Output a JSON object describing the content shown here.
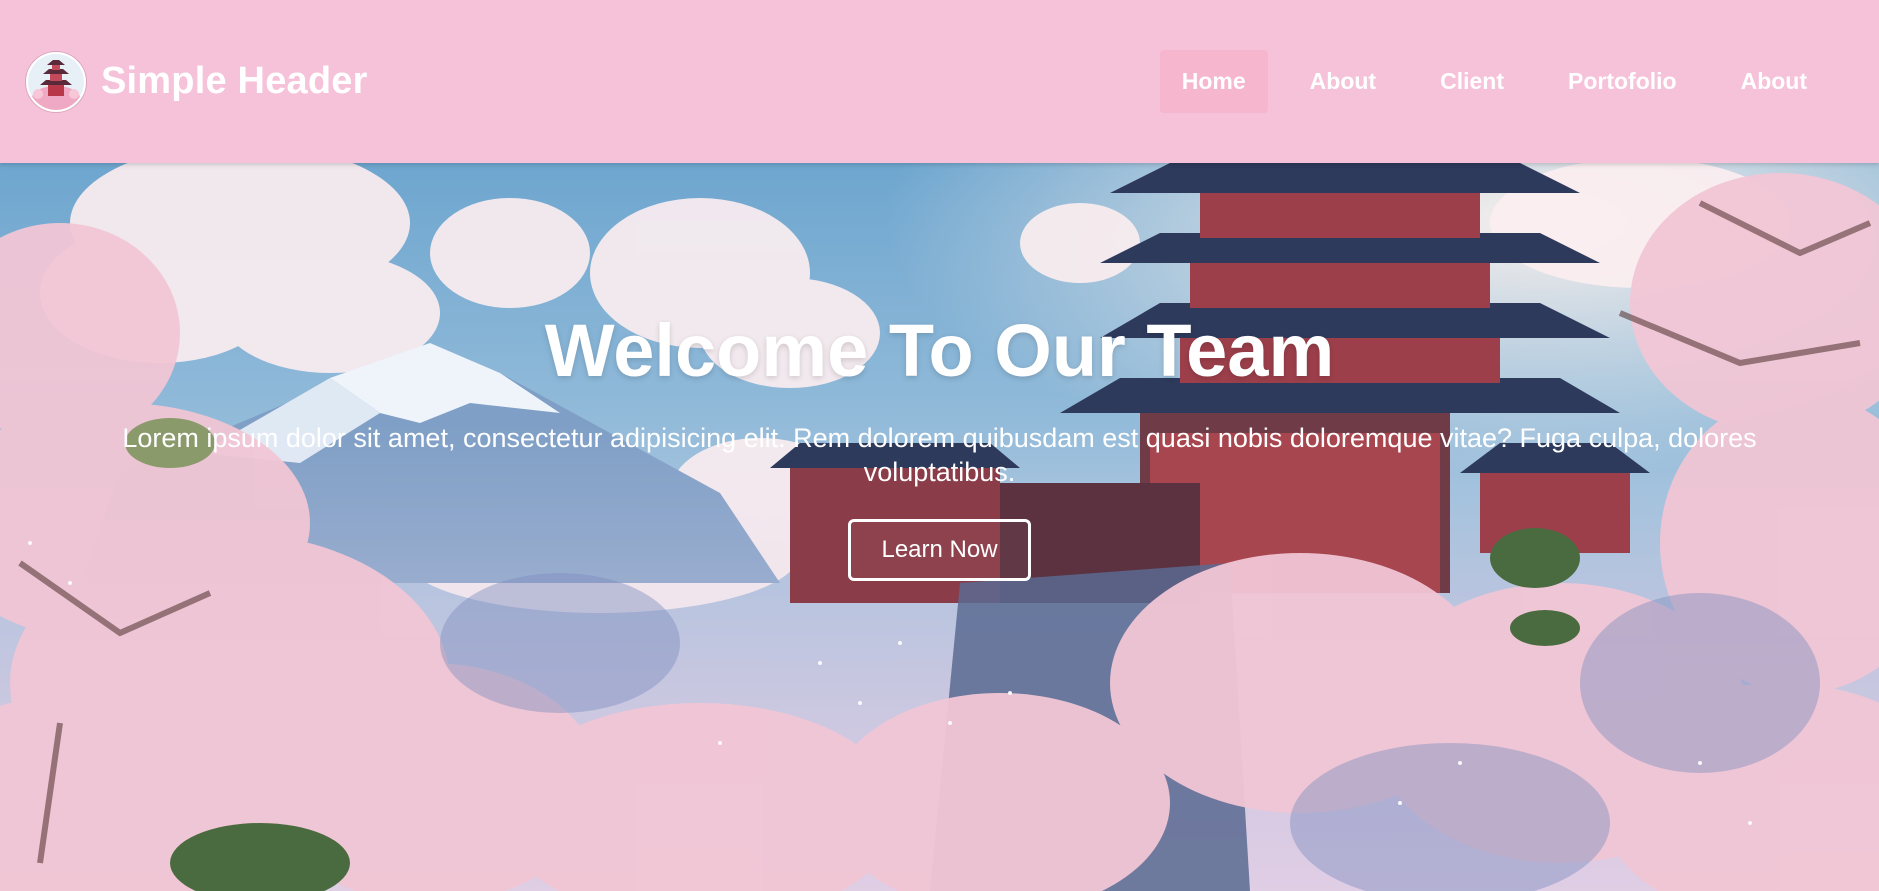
{
  "header": {
    "brand_title": "Simple Header",
    "logo_icon": "pagoda-logo-icon"
  },
  "nav": {
    "items": [
      {
        "label": "Home",
        "active": true
      },
      {
        "label": "About",
        "active": false
      },
      {
        "label": "Client",
        "active": false
      },
      {
        "label": "Portofolio",
        "active": false
      },
      {
        "label": "About",
        "active": false
      }
    ]
  },
  "hero": {
    "title": "Welcome To Our Team",
    "text": "Lorem ipsum dolor sit amet, consectetur adipisicing elit. Rem dolorem quibusdam est quasi nobis doloremque vitae? Fuga culpa, dolores voluptatibus.",
    "button_label": "Learn Now"
  },
  "colors": {
    "header_bg": "#f5c2d9",
    "active_nav_bg": "#f6b6cd",
    "text": "#ffffff"
  }
}
